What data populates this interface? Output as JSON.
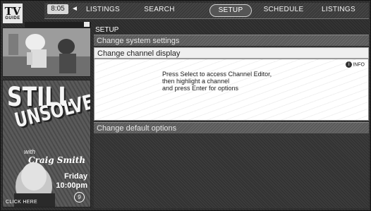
{
  "logo": {
    "line1": "TV",
    "line2": "GUIDE"
  },
  "clock": "8:05",
  "nav": {
    "left_arrow": "◄",
    "tabs": [
      {
        "label": "LISTINGS",
        "active": false
      },
      {
        "label": "SEARCH",
        "active": false
      },
      {
        "label": "SETUP",
        "active": true
      },
      {
        "label": "SCHEDULE",
        "active": false
      },
      {
        "label": "LISTINGS",
        "active": false
      }
    ]
  },
  "ad": {
    "title_line1": "STILL",
    "title_line2": "UNSOLVED",
    "with": "with",
    "host": "Craig Smith",
    "day": "Friday",
    "time": "10:00pm",
    "channel_logo": "9",
    "click_here": "CLICK HERE"
  },
  "setup": {
    "section_label": "SETUP",
    "menu": [
      {
        "label": "Change system settings",
        "selected": false
      },
      {
        "label": "Change channel display",
        "selected": true
      },
      {
        "label": "Change default options",
        "selected": false
      }
    ],
    "info_badge": "INFO",
    "info_icon": "i",
    "info_text": [
      "Press Select to access Channel Editor,",
      "then highlight a channel",
      "and press Enter for options"
    ]
  },
  "colors": {
    "frame_bg": "#2c2c2c",
    "selected_row": "#efefef",
    "dim_row": "#5a5a5a",
    "info_bg": "#ffffff"
  }
}
